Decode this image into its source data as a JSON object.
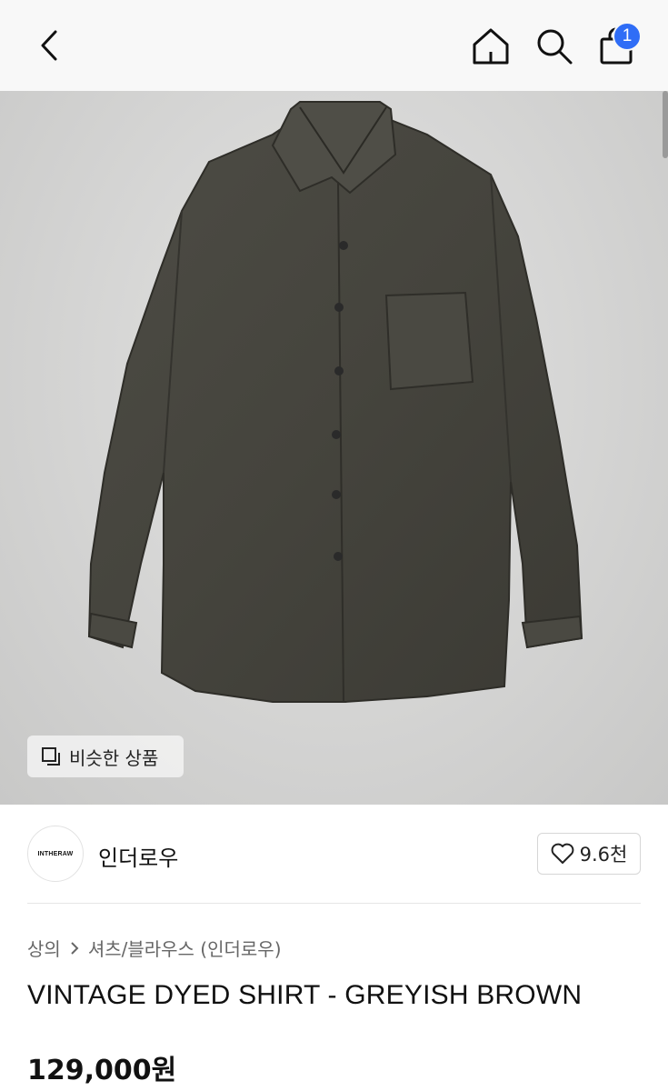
{
  "header": {
    "icons": [
      "chevron-left-icon",
      "home-icon",
      "search-icon",
      "shopping-bag-icon"
    ],
    "cart_count": "1",
    "badge_color": "#2f6df6"
  },
  "hero": {
    "image": "dark greyish brown long-sleeve button-up shirt on light grey background",
    "similar_label": "비슷한 상품"
  },
  "brand": {
    "logo_text": "INTHERAW",
    "name": "인더로우",
    "like_count": "9.6천"
  },
  "product": {
    "breadcrumb": [
      "상의",
      "셔츠/블라우스 (인더로우)"
    ],
    "title": "VINTAGE DYED SHIRT - GREYISH BROWN",
    "price": "129,000원"
  }
}
